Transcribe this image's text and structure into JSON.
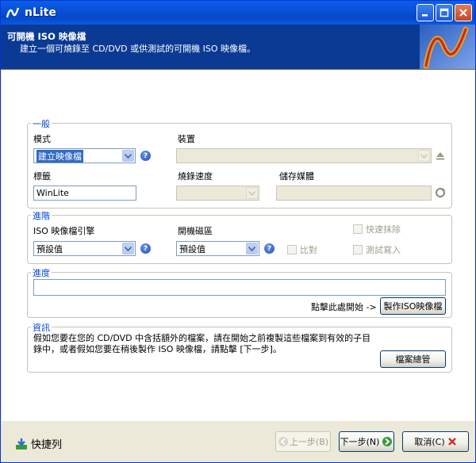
{
  "window": {
    "title": "nLite",
    "min_icon": "minimize-icon",
    "max_icon": "maximize-icon",
    "close_icon": "close-icon"
  },
  "header": {
    "title": "可開機 ISO 映像檔",
    "subtitle": "建立一個可燒錄至 CD/DVD 或供測試的可開機 ISO 映像檔。"
  },
  "general": {
    "legend": "一般",
    "mode_label": "模式",
    "mode_value": "建立映像檔",
    "device_label": "裝置",
    "device_value": "",
    "label_label": "標籤",
    "label_value": "WinLite",
    "burn_speed_label": "燒錄速度",
    "media_label": "儲存媒體"
  },
  "advanced": {
    "legend": "進階",
    "engine_label": "ISO 映像檔引擎",
    "engine_value": "預設值",
    "boot_sector_label": "開機磁區",
    "boot_sector_value": "預設值",
    "compare_label": "比對",
    "quick_erase_label": "快速抹除",
    "test_write_label": "測試寫入"
  },
  "progress": {
    "legend": "進度",
    "hint": "點擊此處開始 ->",
    "make_iso_button": "製作ISO映像檔"
  },
  "info": {
    "legend": "資訊",
    "text": "假如您要在您的 CD/DVD 中含括額外的檔案，請在開始之前複製這些檔案到有效的子目錄中，或者假如您要在稍後製作 ISO 映像檔，請點擊 [下一步]。",
    "file_manager_button": "檔案總管"
  },
  "footer": {
    "quicklink_label": "快捷列",
    "back_button": "上一步(B)",
    "next_button": "下一步(N)",
    "cancel_button": "取消(C)"
  },
  "colors": {
    "accent": "#0046D5",
    "banner": "#0B3A94",
    "titlebar": "#0A50D8"
  }
}
